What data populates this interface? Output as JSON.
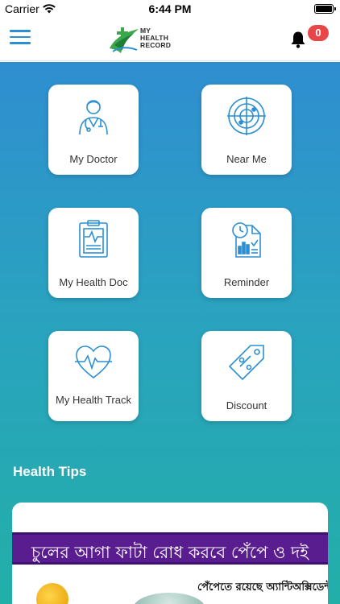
{
  "status_bar": {
    "carrier": "Carrier",
    "time": "6:44 PM"
  },
  "app_bar": {
    "logo_line1": "MY",
    "logo_line2": "HEALTH",
    "logo_line3": "RECORD",
    "notification_count": "0",
    "accent_color": "#2c8fd3",
    "badge_color": "#e8474a"
  },
  "tiles": [
    {
      "label": "My Doctor",
      "icon": "doctor-icon"
    },
    {
      "label": "Near Me",
      "icon": "radar-icon"
    },
    {
      "label": "My Health Doc",
      "icon": "clipboard-icon"
    },
    {
      "label": "Reminder",
      "icon": "reminder-icon"
    },
    {
      "label": "My Health Track",
      "icon": "heart-pulse-icon"
    },
    {
      "label": "Discount",
      "icon": "discount-tag-icon"
    }
  ],
  "health_tips": {
    "title": "Health Tips",
    "banner_text": "চুলের আগা ফাটা রোধ করবে পেঁপে ও দই",
    "subtext": "পেঁপেতে রয়েছে অ্যান্টিঅক্সিডেন্ট"
  }
}
